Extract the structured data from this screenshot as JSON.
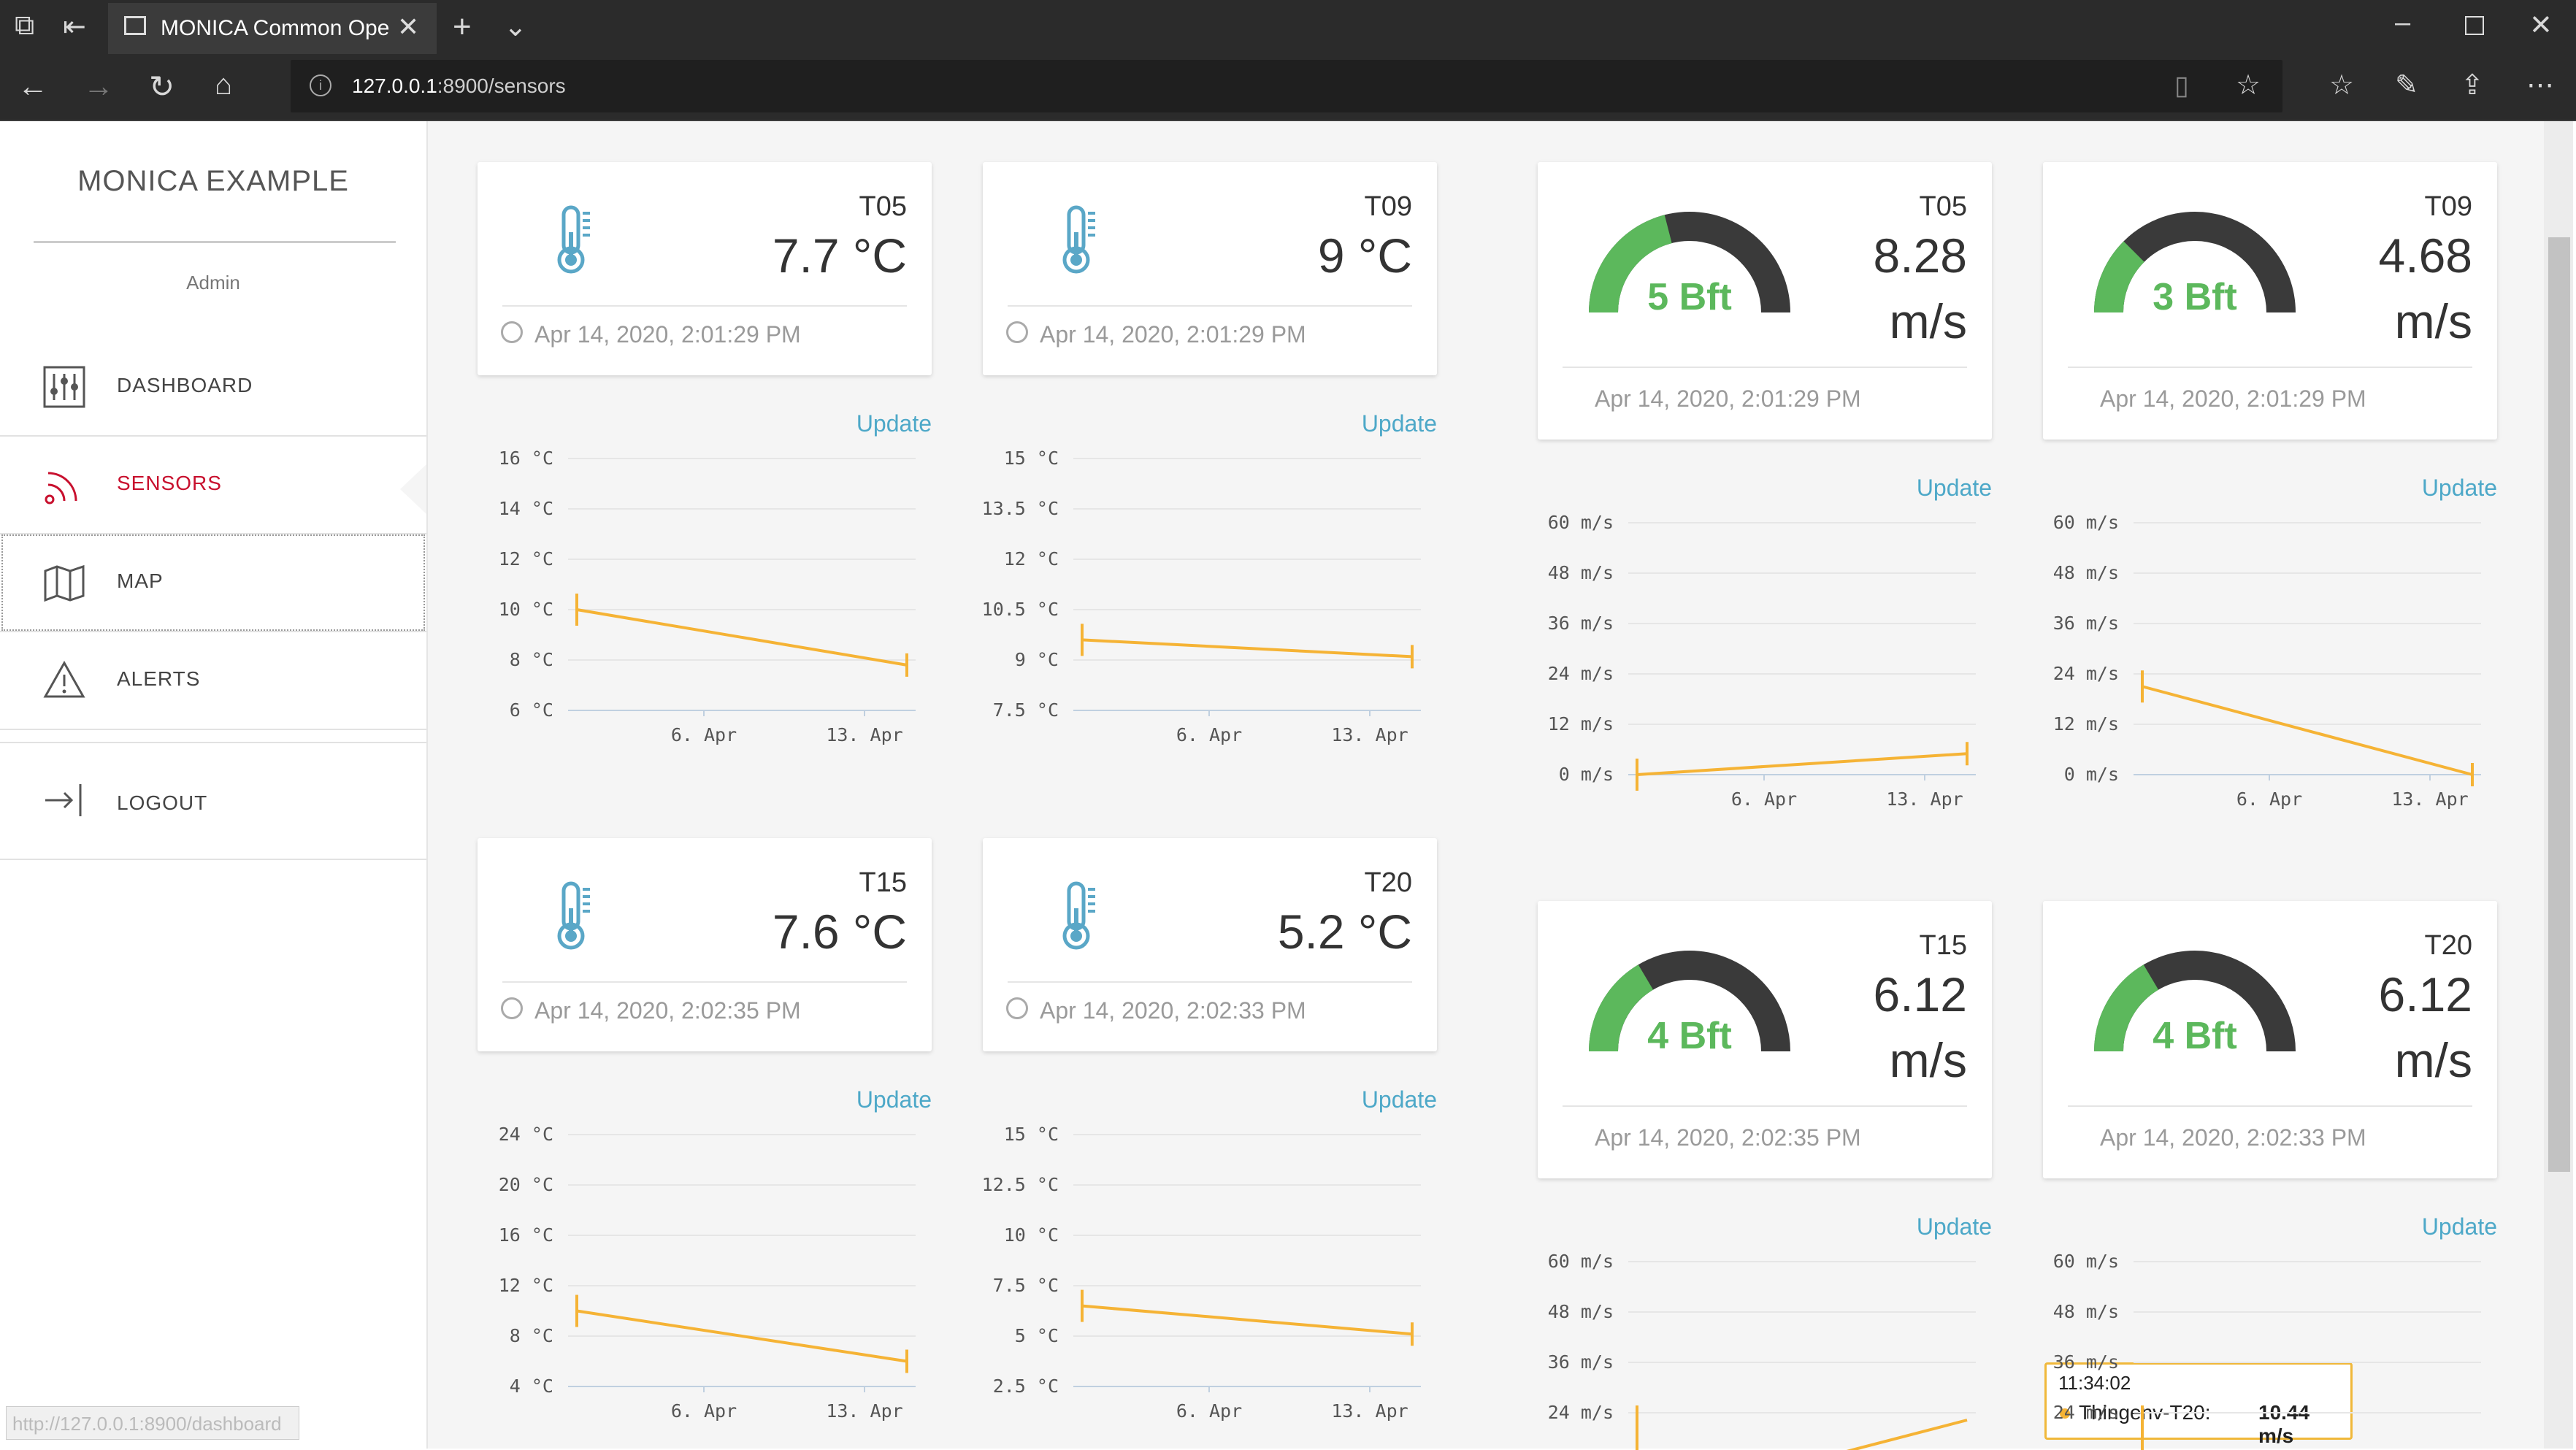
{
  "browser": {
    "tab_title": "MONICA Common Ope",
    "url_host": "127.0.0.1",
    "url_rest": ":8900/sensors",
    "status_url": "http://127.0.0.1:8900/dashboard"
  },
  "sidebar": {
    "brand": "MONICA EXAMPLE",
    "user": "Admin",
    "items": [
      {
        "label": "DASHBOARD"
      },
      {
        "label": "SENSORS"
      },
      {
        "label": "MAP"
      },
      {
        "label": "ALERTS"
      },
      {
        "label": "LOGOUT"
      }
    ]
  },
  "update_label": "Update",
  "temp_cards": [
    {
      "name": "T05",
      "value": "7.7 °C",
      "time": "Apr 14, 2020, 2:01:29 PM"
    },
    {
      "name": "T09",
      "value": "9 °C",
      "time": "Apr 14, 2020, 2:01:29 PM"
    },
    {
      "name": "T15",
      "value": "7.6 °C",
      "time": "Apr 14, 2020, 2:02:35 PM"
    },
    {
      "name": "T20",
      "value": "5.2 °C",
      "time": "Apr 14, 2020, 2:02:33 PM"
    }
  ],
  "wind_cards": [
    {
      "name": "T05",
      "value": "8.28",
      "unit": "m/s",
      "bft": "5 Bft",
      "level": 0.42,
      "time": "Apr 14, 2020, 2:01:29 PM"
    },
    {
      "name": "T09",
      "value": "4.68",
      "unit": "m/s",
      "bft": "3 Bft",
      "level": 0.25,
      "time": "Apr 14, 2020, 2:01:29 PM"
    },
    {
      "name": "T15",
      "value": "6.12",
      "unit": "m/s",
      "bft": "4 Bft",
      "level": 0.33,
      "time": "Apr 14, 2020, 2:02:35 PM"
    },
    {
      "name": "T20",
      "value": "6.12",
      "unit": "m/s",
      "bft": "4 Bft",
      "level": 0.33,
      "time": "Apr 14, 2020, 2:02:33 PM"
    }
  ],
  "tooltip": {
    "time": "11:34:02",
    "series": "Thingenv-T20:",
    "value": "10.44 m/s"
  },
  "colors": {
    "accent": "#c8102e",
    "line": "#f5b335",
    "gauge_green": "#5cb85c",
    "gauge_dark": "#3a3a3a",
    "thermo": "#5aa7c7"
  },
  "chart_data": [
    {
      "type": "line",
      "series_name": "T05 temperature",
      "yticks": [
        "16 °C",
        "14 °C",
        "12 °C",
        "10 °C",
        "8 °C",
        "6 °C"
      ],
      "ylim": [
        6,
        16
      ],
      "xticks": [
        "6. Apr",
        "13. Apr"
      ],
      "points": [
        10,
        7.8
      ]
    },
    {
      "type": "line",
      "series_name": "T09 temperature",
      "yticks": [
        "15 °C",
        "13.5 °C",
        "12 °C",
        "10.5 °C",
        "9 °C",
        "7.5 °C"
      ],
      "ylim": [
        7.5,
        15
      ],
      "xticks": [
        "6. Apr",
        "13. Apr"
      ],
      "points": [
        9.6,
        9.1
      ]
    },
    {
      "type": "line",
      "series_name": "T15 temperature",
      "yticks": [
        "24 °C",
        "20 °C",
        "16 °C",
        "12 °C",
        "8 °C",
        "4 °C"
      ],
      "ylim": [
        4,
        24
      ],
      "xticks": [
        "6. Apr",
        "13. Apr"
      ],
      "points": [
        10,
        6
      ]
    },
    {
      "type": "line",
      "series_name": "T20 temperature",
      "yticks": [
        "15 °C",
        "12.5 °C",
        "10 °C",
        "7.5 °C",
        "5 °C",
        "2.5 °C"
      ],
      "ylim": [
        2.5,
        15
      ],
      "xticks": [
        "6. Apr",
        "13. Apr"
      ],
      "points": [
        6.5,
        5.1
      ]
    },
    {
      "type": "line",
      "series_name": "T05 wind",
      "yticks": [
        "60 m/s",
        "48 m/s",
        "36 m/s",
        "24 m/s",
        "12 m/s",
        "0 m/s"
      ],
      "ylim": [
        0,
        60
      ],
      "xticks": [
        "6. Apr",
        "13. Apr"
      ],
      "points": [
        0,
        5
      ]
    },
    {
      "type": "line",
      "series_name": "T09 wind",
      "yticks": [
        "60 m/s",
        "48 m/s",
        "36 m/s",
        "24 m/s",
        "12 m/s",
        "0 m/s"
      ],
      "ylim": [
        0,
        60
      ],
      "xticks": [
        "6. Apr",
        "13. Apr"
      ],
      "points": [
        21,
        0
      ]
    },
    {
      "type": "line",
      "series_name": "T15 wind",
      "yticks": [
        "60 m/s",
        "48 m/s",
        "36 m/s",
        "24 m/s"
      ],
      "ylim": [
        0,
        60
      ],
      "xticks": [],
      "points": []
    },
    {
      "type": "line",
      "series_name": "T20 wind",
      "yticks": [
        "60 m/s",
        "48 m/s",
        "36 m/s",
        "24 m/s"
      ],
      "ylim": [
        0,
        60
      ],
      "xticks": [],
      "points": []
    }
  ]
}
